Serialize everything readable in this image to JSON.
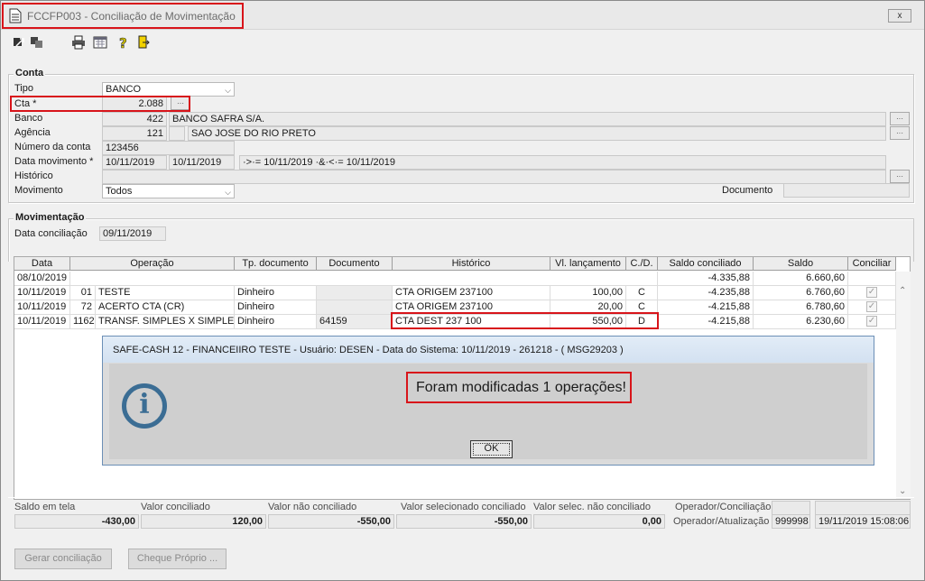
{
  "window": {
    "title": "FCCFP003 - Conciliação de Movimentação",
    "close_label": "x"
  },
  "toolbar": {
    "icons": [
      "export-icon",
      "import-icon",
      "print-icon",
      "calculator-icon",
      "help-icon",
      "exit-icon"
    ]
  },
  "conta": {
    "group_title": "Conta",
    "tipo_label": "Tipo",
    "tipo_value": "BANCO",
    "cta_label": "Cta *",
    "cta_value": "2.088",
    "banco_label": "Banco",
    "banco_code": "422",
    "banco_name": "BANCO SAFRA S/A.",
    "agencia_label": "Agência",
    "agencia_code": "121",
    "agencia_name": "SAO JOSE DO RIO PRETO",
    "numero_label": "Número da conta",
    "numero_value": "123456",
    "data_mov_label": "Data movimento *",
    "data_mov_from": "10/11/2019",
    "data_mov_to": "10/11/2019",
    "data_mov_expr": "·>·= 10/11/2019 ·&·<·= 10/11/2019",
    "historico_label": "Histórico",
    "historico_value": "",
    "movimento_label": "Movimento",
    "movimento_value": "Todos",
    "documento_label": "Documento",
    "documento_value": ""
  },
  "movimentacao": {
    "group_title": "Movimentação",
    "data_conc_label": "Data conciliação",
    "data_conc_value": "09/11/2019"
  },
  "grid": {
    "headers": [
      "Data",
      "Operação",
      "Tp. documento",
      "Documento",
      "Histórico",
      "Vl. lançamento",
      "C./D.",
      "Saldo conciliado",
      "Saldo",
      "Conciliar"
    ],
    "rows": [
      {
        "data": "08/10/2019",
        "op_code": "",
        "op_name": "",
        "tp_doc": "",
        "documento": "",
        "historico": "",
        "valor": "",
        "cd": "",
        "saldo_conc": "-4.335,88",
        "saldo": "6.660,60",
        "check": ""
      },
      {
        "data": "10/11/2019",
        "op_code": "01",
        "op_name": "TESTE",
        "tp_doc": "Dinheiro",
        "documento": "",
        "historico": "CTA ORIGEM  237100",
        "valor": "100,00",
        "cd": "C",
        "saldo_conc": "-4.235,88",
        "saldo": "6.760,60",
        "check": "✓"
      },
      {
        "data": "10/11/2019",
        "op_code": "72",
        "op_name": "ACERTO CTA (CR)",
        "tp_doc": "Dinheiro",
        "documento": "",
        "historico": "CTA ORIGEM  237100",
        "valor": "20,00",
        "cd": "C",
        "saldo_conc": "-4.215,88",
        "saldo": "6.780,60",
        "check": "✓"
      },
      {
        "data": "10/11/2019",
        "op_code": "1162",
        "op_name": "TRANSF. SIMPLES X SIMPLES",
        "tp_doc": "Dinheiro",
        "documento": "64159",
        "historico": "CTA DEST  237 100",
        "valor": "550,00",
        "cd": "D",
        "saldo_conc": "-4.215,88",
        "saldo": "6.230,60",
        "check": "✓"
      }
    ],
    "scroll_up": "⌃",
    "scroll_down": "⌄"
  },
  "dialog": {
    "title": "SAFE-CASH 12 - FINANCEIIRO TESTE - Usuário: DESEN - Data do Sistema: 10/11/2019 - 261218 - ( MSG29203 )",
    "info_glyph": "i",
    "message": "Foram modificadas 1 operações!",
    "ok_label": "OK"
  },
  "totals": {
    "saldo_tela_label": "Saldo em tela",
    "saldo_tela": "-430,00",
    "valor_conc_label": "Valor conciliado",
    "valor_conc": "120,00",
    "valor_nao_conc_label": "Valor não conciliado",
    "valor_nao_conc": "-550,00",
    "valor_sel_conc_label": "Valor selecionado conciliado",
    "valor_sel_conc": "-550,00",
    "valor_sel_nao_label": "Valor selec. não conciliado",
    "valor_sel_nao": "0,00",
    "op_conc_label": "Operador/Conciliação",
    "op_conc_user": "",
    "op_conc_time": "",
    "op_atual_label": "Operador/Atualização",
    "op_atual_user": "999998",
    "op_atual_time": "19/11/2019 15:08:06"
  },
  "buttons": {
    "gerar": "Gerar conciliação",
    "cheque": "Cheque Próprio ..."
  },
  "colors": {
    "highlight": "#d8141a",
    "dialog_icon": "#3b6d94"
  }
}
